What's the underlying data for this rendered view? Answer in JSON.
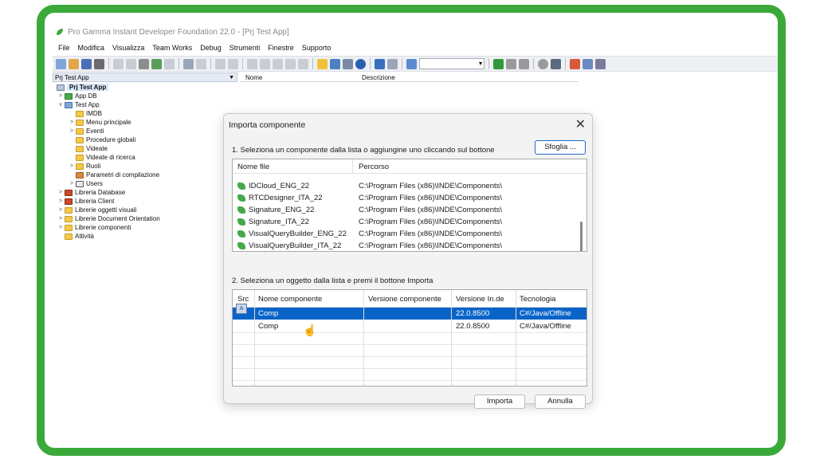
{
  "app": {
    "title": "Pro Gamma Instant Developer Foundation 22.0 - [Prj Test App]"
  },
  "menu": [
    "File",
    "Modifica",
    "Visualizza",
    "Team Works",
    "Debug",
    "Strumenti",
    "Finestre",
    "Supporto"
  ],
  "left_panel": {
    "header": "Prj Test App",
    "tree": [
      {
        "label": "Prj Test App",
        "depth": 0,
        "expander": "",
        "icon": "project-icon"
      },
      {
        "label": "App DB",
        "depth": 1,
        "expander": ">",
        "icon": "database-icon"
      },
      {
        "label": "Test App",
        "depth": 1,
        "expander": "v",
        "icon": "app-icon"
      },
      {
        "label": "IMDB",
        "depth": 2,
        "expander": "",
        "icon": "folder-icon"
      },
      {
        "label": "Menu principale",
        "depth": 2,
        "expander": ">",
        "icon": "folder-icon"
      },
      {
        "label": "Eventi",
        "depth": 2,
        "expander": ">",
        "icon": "folder-icon"
      },
      {
        "label": "Procedure globali",
        "depth": 2,
        "expander": "",
        "icon": "folder-icon"
      },
      {
        "label": "Videate",
        "depth": 2,
        "expander": "",
        "icon": "folder-icon"
      },
      {
        "label": "Videate di ricerca",
        "depth": 2,
        "expander": "",
        "icon": "folder-icon"
      },
      {
        "label": "Ruoli",
        "depth": 2,
        "expander": ">",
        "icon": "folder-icon"
      },
      {
        "label": "Parametri di compilazione",
        "depth": 2,
        "expander": "",
        "icon": "settings-icon"
      },
      {
        "label": "Users",
        "depth": 2,
        "expander": ">",
        "icon": "table-icon"
      },
      {
        "label": "Libreria Database",
        "depth": 1,
        "expander": ">",
        "icon": "library-icon"
      },
      {
        "label": "Libreria Client",
        "depth": 1,
        "expander": ">",
        "icon": "library-icon"
      },
      {
        "label": "Librerie oggetti visuali",
        "depth": 1,
        "expander": ">",
        "icon": "folder-icon"
      },
      {
        "label": "Librerie Document Orientation",
        "depth": 1,
        "expander": ">",
        "icon": "folder-icon"
      },
      {
        "label": "Librerie componenti",
        "depth": 1,
        "expander": ">",
        "icon": "folder-icon"
      },
      {
        "label": "Attività",
        "depth": 1,
        "expander": "",
        "icon": "folder-icon"
      }
    ]
  },
  "right_panel": {
    "col_name": "Nome",
    "col_desc": "Descrizione"
  },
  "dialog": {
    "title": "Importa componente",
    "close_label": "✕",
    "step1_label": "1. Seleziona un componente dalla lista o aggiungine uno cliccando sul bottone",
    "browse_label": "Sfoglia ...",
    "list_headers": {
      "file": "Nome file",
      "path": "Percorso"
    },
    "files": [
      {
        "name": "IDCloud_ENG_22",
        "path": "C:\\Program Files (x86)\\INDE\\Components\\"
      },
      {
        "name": "RTCDesigner_ITA_22",
        "path": "C:\\Program Files (x86)\\INDE\\Components\\"
      },
      {
        "name": "Signature_ENG_22",
        "path": "C:\\Program Files (x86)\\INDE\\Components\\"
      },
      {
        "name": "Signature_ITA_22",
        "path": "C:\\Program Files (x86)\\INDE\\Components\\"
      },
      {
        "name": "VisualQueryBuilder_ENG_22",
        "path": "C:\\Program Files (x86)\\INDE\\Components\\"
      },
      {
        "name": "VisualQueryBuilder_ITA_22",
        "path": "C:\\Program Files (x86)\\INDE\\Components\\"
      }
    ],
    "step2_label": "2. Seleziona un oggetto dalla lista e premi il bottone Importa",
    "grid_headers": {
      "src": "Src",
      "name": "Nome componente",
      "version": "Versione componente",
      "inde_version": "Versione In.de",
      "tech": "Tecnologia"
    },
    "components": [
      {
        "name": "Comp",
        "version": "",
        "inde_version": "22.0.8500",
        "tech": "C#/Java/Offline",
        "selected": true
      },
      {
        "name": "Comp",
        "version": "",
        "inde_version": "22.0.8500",
        "tech": "C#/Java/Offline",
        "selected": false
      }
    ],
    "import_label": "Importa",
    "cancel_label": "Annulla"
  },
  "colors": {
    "frame": "#3aa93a",
    "selection": "#0a64c8",
    "accent_border": "#1d6ad0"
  }
}
